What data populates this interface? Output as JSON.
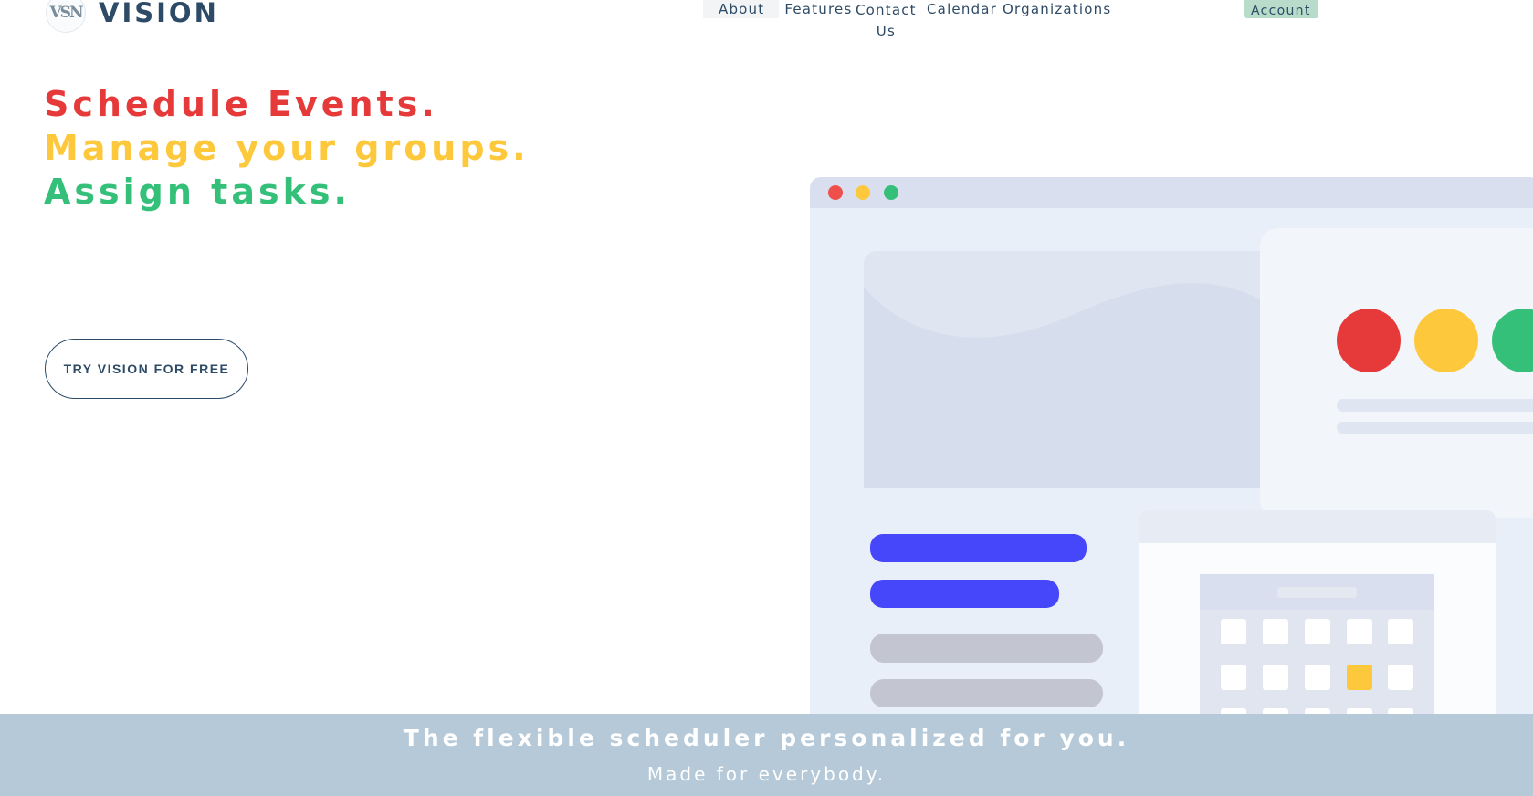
{
  "brand": {
    "logo_mark": "VSN",
    "name": "VISION"
  },
  "nav": {
    "about": "About",
    "features": "Features",
    "contact_line1": "Contact",
    "contact_line2": "Us",
    "calendar": "Calendar Organizations",
    "account": "Account"
  },
  "hero": {
    "line1": "Schedule Events.",
    "line2": "Manage your groups.",
    "line3": "Assign tasks.",
    "cta": "TRY VISION FOR FREE"
  },
  "band": {
    "title": "The flexible scheduler personalized for you.",
    "subtitle": "Made for everybody."
  },
  "colors": {
    "red": "#e63a3a",
    "yellow": "#fdc83b",
    "green": "#35c07a",
    "navy": "#2d4a66",
    "band": "#b5c9d8",
    "accent_blue": "#4646fb"
  }
}
